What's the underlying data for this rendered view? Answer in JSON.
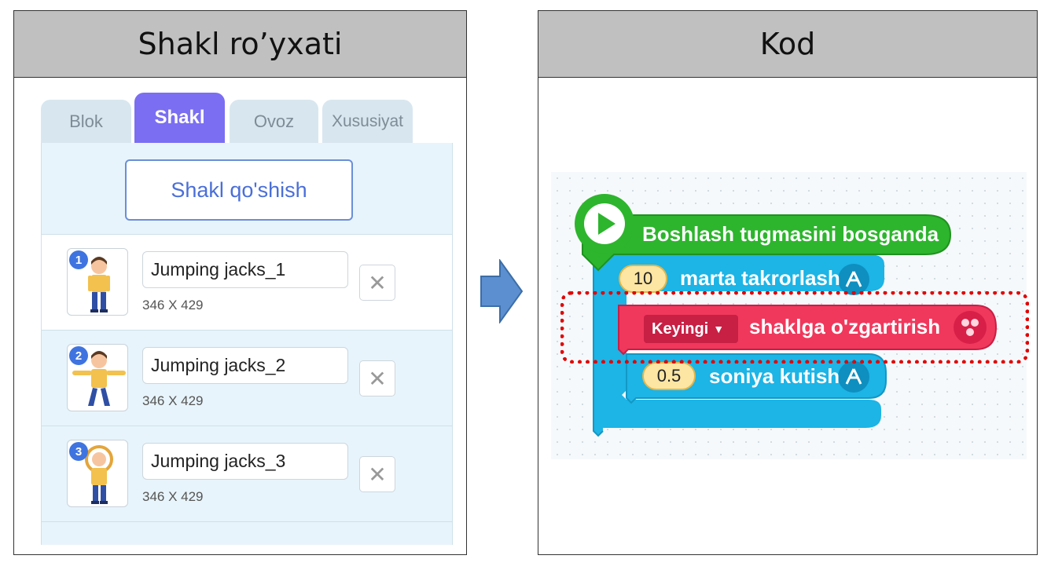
{
  "left_panel": {
    "title": "Shakl ro’yxati",
    "tabs": [
      {
        "label": "Blok",
        "active": false
      },
      {
        "label": "Shakl",
        "active": true
      },
      {
        "label": "Ovoz",
        "active": false
      },
      {
        "label": "Xususiyat",
        "active": false
      }
    ],
    "add_button_label": "Shakl qo'shish",
    "shapes": [
      {
        "number": "1",
        "name": "Jumping jacks_1",
        "size": "346 X 429",
        "pose": "arms-down"
      },
      {
        "number": "2",
        "name": "Jumping jacks_2",
        "size": "346 X 429",
        "pose": "arms-out"
      },
      {
        "number": "3",
        "name": "Jumping jacks_3",
        "size": "346 X 429",
        "pose": "arms-up"
      }
    ],
    "delete_symbol": "✕"
  },
  "right_panel": {
    "title": "Kod",
    "blocks": {
      "start": {
        "label": "Boshlash tugmasini bosganda",
        "icon": "play-icon",
        "color": "#2db52d"
      },
      "repeat": {
        "count": "10",
        "label": "marta takrorlash",
        "icon": "flow-icon",
        "color": "#1db4e6"
      },
      "change_shape": {
        "dropdown": "Keyingi",
        "label": "shaklga o'zgartirish",
        "icon": "shape-icon",
        "color": "#f0385c"
      },
      "wait": {
        "seconds": "0.5",
        "label": "soniya kutish",
        "icon": "flow-icon",
        "color": "#1db4e6"
      }
    },
    "highlight_color": "#e00000"
  },
  "arrow_color": "#5b8fcf"
}
